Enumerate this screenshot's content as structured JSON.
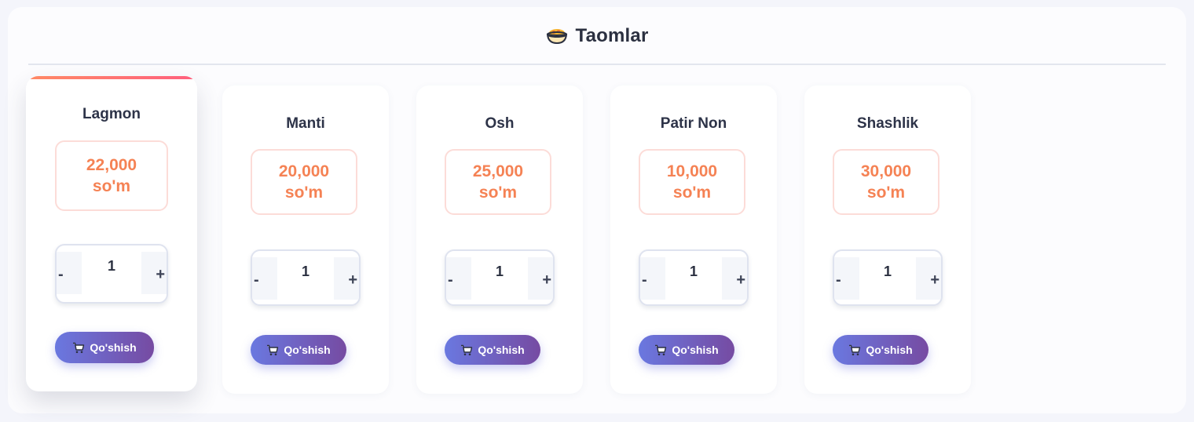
{
  "header": {
    "icon": "bowl-food-icon",
    "title": "Taomlar"
  },
  "colors": {
    "accent_gradient_start": "#6a78e0",
    "accent_gradient_end": "#764ba2",
    "price_color": "#f58254",
    "highlight_bar": "#ff6b6b"
  },
  "items": [
    {
      "name": "Lagmon",
      "price": "22,000",
      "currency": "so'm",
      "quantity": "1",
      "minus": "-",
      "plus": "+",
      "button": "Qo'shish",
      "button_icon": "cart-icon"
    },
    {
      "name": "Manti",
      "price": "20,000",
      "currency": "so'm",
      "quantity": "1",
      "minus": "-",
      "plus": "+",
      "button": "Qo'shish",
      "button_icon": "cart-icon"
    },
    {
      "name": "Osh",
      "price": "25,000",
      "currency": "so'm",
      "quantity": "1",
      "minus": "-",
      "plus": "+",
      "button": "Qo'shish",
      "button_icon": "cart-icon"
    },
    {
      "name": "Patir Non",
      "price": "10,000",
      "currency": "so'm",
      "quantity": "1",
      "minus": "-",
      "plus": "+",
      "button": "Qo'shish",
      "button_icon": "cart-icon"
    },
    {
      "name": "Shashlik",
      "price": "30,000",
      "currency": "so'm",
      "quantity": "1",
      "minus": "-",
      "plus": "+",
      "button": "Qo'shish",
      "button_icon": "cart-icon"
    }
  ]
}
